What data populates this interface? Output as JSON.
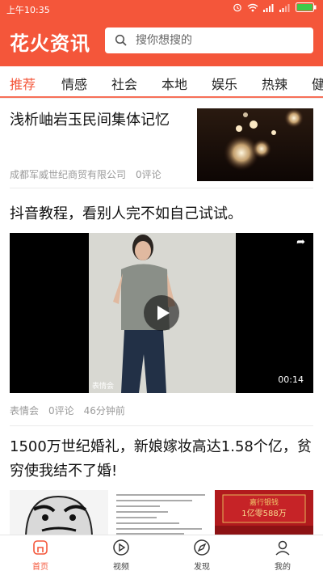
{
  "status_bar": {
    "time": "上午10:35"
  },
  "header": {
    "app_title": "花火资讯",
    "search_placeholder": "搜你想搜的"
  },
  "tabs": [
    {
      "label": "推荐",
      "active": true
    },
    {
      "label": "情感"
    },
    {
      "label": "社会"
    },
    {
      "label": "本地"
    },
    {
      "label": "娱乐"
    },
    {
      "label": "热辣"
    },
    {
      "label": "健"
    }
  ],
  "feed": [
    {
      "title": "浅析岫岩玉民间集体记忆",
      "source": "成都军威世纪商贸有限公司",
      "comments": "0评论",
      "thumb_icon": "night-lights-image"
    },
    {
      "title": "抖音教程，看别人完不如自己试试。",
      "video_duration": "00:14",
      "video_watermark": "表情会",
      "source": "表情会",
      "comments": "0评论",
      "time_ago": "46分钟前"
    },
    {
      "title": "1500万世纪婚礼，新娘嫁妆高达1.58个亿，贫穷使我结不了婚!",
      "images": [
        "meme-face-image",
        "document-image",
        "red-banner-image"
      ],
      "red_banner_text_1": "嘉行银钱",
      "red_banner_text_2": "1亿零588万"
    }
  ],
  "bottom_nav": [
    {
      "label": "首页",
      "icon": "home-icon",
      "active": true
    },
    {
      "label": "视频",
      "icon": "play-circle-icon"
    },
    {
      "label": "发现",
      "icon": "compass-icon"
    },
    {
      "label": "我的",
      "icon": "user-icon"
    }
  ],
  "colors": {
    "accent": "#f4563a",
    "text": "#111111",
    "meta": "#9a9a9a"
  }
}
